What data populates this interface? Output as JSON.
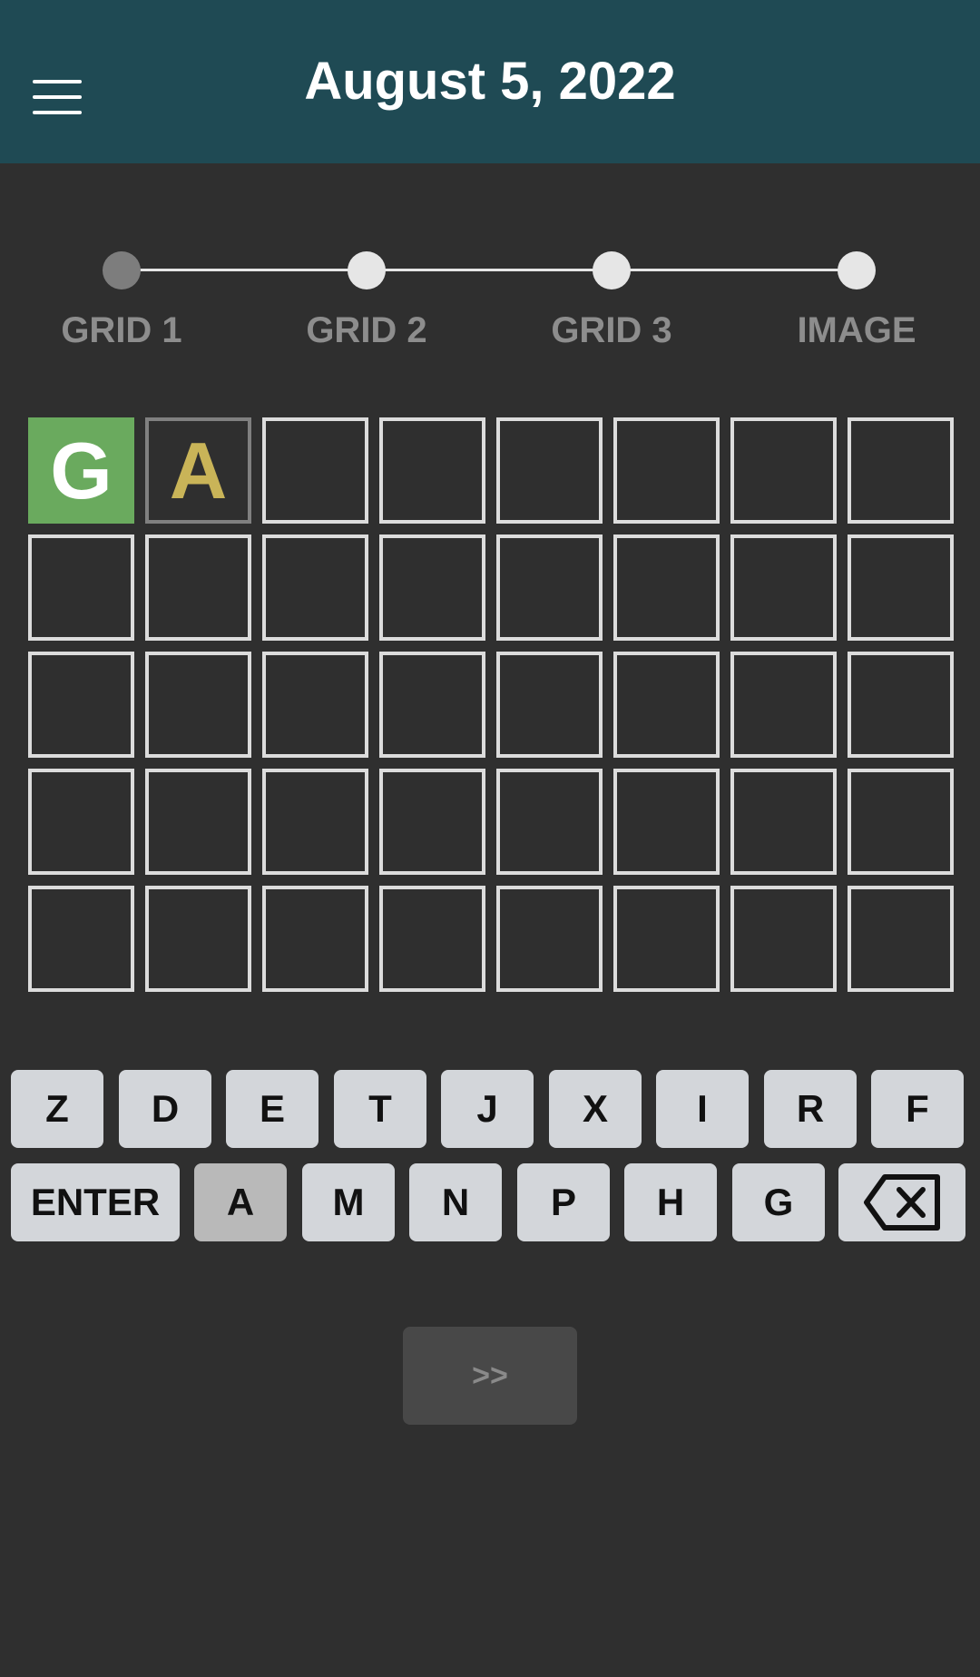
{
  "header": {
    "title": "August 5, 2022",
    "menu_icon": "hamburger-menu-icon"
  },
  "progress": {
    "steps": [
      {
        "label": "GRID 1",
        "active": true
      },
      {
        "label": "GRID 2",
        "active": false
      },
      {
        "label": "GRID 3",
        "active": false
      },
      {
        "label": "IMAGE",
        "active": false
      }
    ]
  },
  "grid": {
    "rows": [
      [
        {
          "letter": "G",
          "state": "correct"
        },
        {
          "letter": "A",
          "state": "present"
        },
        {
          "letter": "",
          "state": "empty"
        },
        {
          "letter": "",
          "state": "empty"
        },
        {
          "letter": "",
          "state": "empty"
        },
        {
          "letter": "",
          "state": "empty"
        },
        {
          "letter": "",
          "state": "empty"
        },
        {
          "letter": "",
          "state": "empty"
        }
      ],
      [
        {
          "letter": "",
          "state": "empty"
        },
        {
          "letter": "",
          "state": "empty"
        },
        {
          "letter": "",
          "state": "empty"
        },
        {
          "letter": "",
          "state": "empty"
        },
        {
          "letter": "",
          "state": "empty"
        },
        {
          "letter": "",
          "state": "empty"
        },
        {
          "letter": "",
          "state": "empty"
        },
        {
          "letter": "",
          "state": "empty"
        }
      ],
      [
        {
          "letter": "",
          "state": "empty"
        },
        {
          "letter": "",
          "state": "empty"
        },
        {
          "letter": "",
          "state": "empty"
        },
        {
          "letter": "",
          "state": "empty"
        },
        {
          "letter": "",
          "state": "empty"
        },
        {
          "letter": "",
          "state": "empty"
        },
        {
          "letter": "",
          "state": "empty"
        },
        {
          "letter": "",
          "state": "empty"
        }
      ],
      [
        {
          "letter": "",
          "state": "empty"
        },
        {
          "letter": "",
          "state": "empty"
        },
        {
          "letter": "",
          "state": "empty"
        },
        {
          "letter": "",
          "state": "empty"
        },
        {
          "letter": "",
          "state": "empty"
        },
        {
          "letter": "",
          "state": "empty"
        },
        {
          "letter": "",
          "state": "empty"
        },
        {
          "letter": "",
          "state": "empty"
        }
      ],
      [
        {
          "letter": "",
          "state": "empty"
        },
        {
          "letter": "",
          "state": "empty"
        },
        {
          "letter": "",
          "state": "empty"
        },
        {
          "letter": "",
          "state": "empty"
        },
        {
          "letter": "",
          "state": "empty"
        },
        {
          "letter": "",
          "state": "empty"
        },
        {
          "letter": "",
          "state": "empty"
        },
        {
          "letter": "",
          "state": "empty"
        }
      ]
    ]
  },
  "keyboard": {
    "row1": [
      "Z",
      "D",
      "E",
      "T",
      "J",
      "X",
      "I",
      "R",
      "F"
    ],
    "row2": [
      "ENTER",
      "A",
      "M",
      "N",
      "P",
      "H",
      "G"
    ],
    "used": [
      "A"
    ],
    "backspace_icon": "backspace-icon"
  },
  "next_button": {
    "label": ">>"
  },
  "colors": {
    "header": "#1f4a54",
    "background": "#2f2f2f",
    "correct": "#6aaa5e",
    "present": "#c9b458",
    "key": "#d3d6da"
  }
}
